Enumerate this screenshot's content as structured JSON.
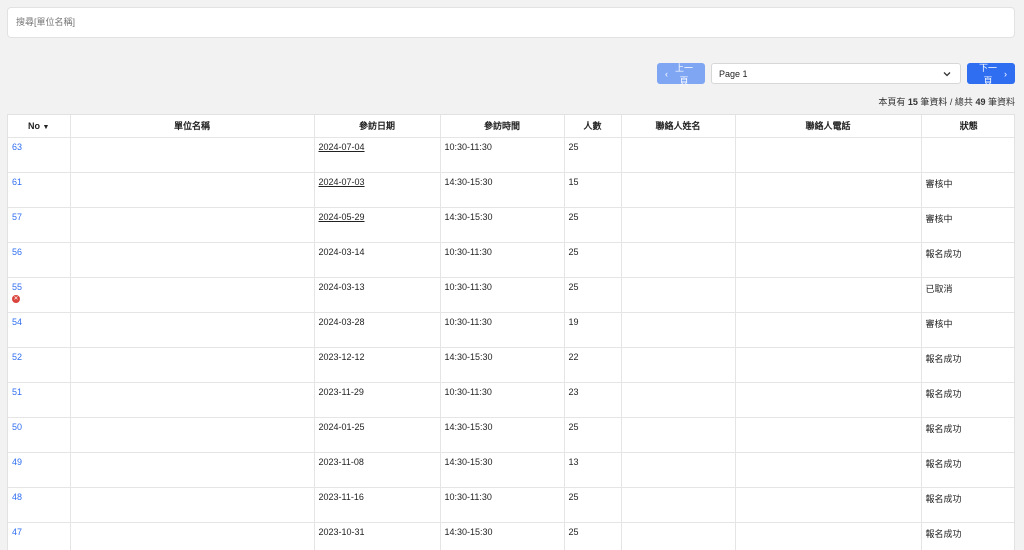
{
  "search": {
    "placeholder": "搜尋[單位名稱]"
  },
  "pager": {
    "prev_label": "上一頁",
    "next_label": "下一頁",
    "page_selected": "Page 1"
  },
  "summary": {
    "prefix": "本頁有",
    "page_count": "15",
    "middle": "筆資料 / 總共",
    "total": "49",
    "suffix": "筆資料"
  },
  "table": {
    "headers": {
      "no": "No",
      "unit": "單位名稱",
      "date": "參訪日期",
      "time": "參訪時間",
      "people": "人數",
      "contact": "聯絡人姓名",
      "phone": "聯絡人電話",
      "status": "狀態"
    },
    "rows": [
      {
        "no": "63",
        "date": "2024-07-04",
        "time": "10:30-11:30",
        "people": "25",
        "status": ""
      },
      {
        "no": "61",
        "date": "2024-07-03",
        "time": "14:30-15:30",
        "people": "15",
        "status": "審核中"
      },
      {
        "no": "57",
        "date": "2024-05-29",
        "time": "14:30-15:30",
        "people": "25",
        "status": "審核中"
      },
      {
        "no": "56",
        "date": "2024-03-14",
        "time": "10:30-11:30",
        "people": "25",
        "status": "報名成功"
      },
      {
        "no": "55",
        "date": "2024-03-13",
        "time": "10:30-11:30",
        "people": "25",
        "status": "已取消"
      },
      {
        "no": "54",
        "date": "2024-03-28",
        "time": "10:30-11:30",
        "people": "19",
        "status": "審核中"
      },
      {
        "no": "52",
        "date": "2023-12-12",
        "time": "14:30-15:30",
        "people": "22",
        "status": "報名成功"
      },
      {
        "no": "51",
        "date": "2023-11-29",
        "time": "10:30-11:30",
        "people": "23",
        "status": "報名成功"
      },
      {
        "no": "50",
        "date": "2024-01-25",
        "time": "14:30-15:30",
        "people": "25",
        "status": "報名成功"
      },
      {
        "no": "49",
        "date": "2023-11-08",
        "time": "14:30-15:30",
        "people": "13",
        "status": "報名成功"
      },
      {
        "no": "48",
        "date": "2023-11-16",
        "time": "10:30-11:30",
        "people": "25",
        "status": "報名成功"
      },
      {
        "no": "47",
        "date": "2023-10-31",
        "time": "14:30-15:30",
        "people": "25",
        "status": "報名成功"
      }
    ]
  },
  "colors": {
    "accent": "#2f6ef0",
    "accent_light": "#7fa6f3",
    "cancel": "#d9443c"
  }
}
